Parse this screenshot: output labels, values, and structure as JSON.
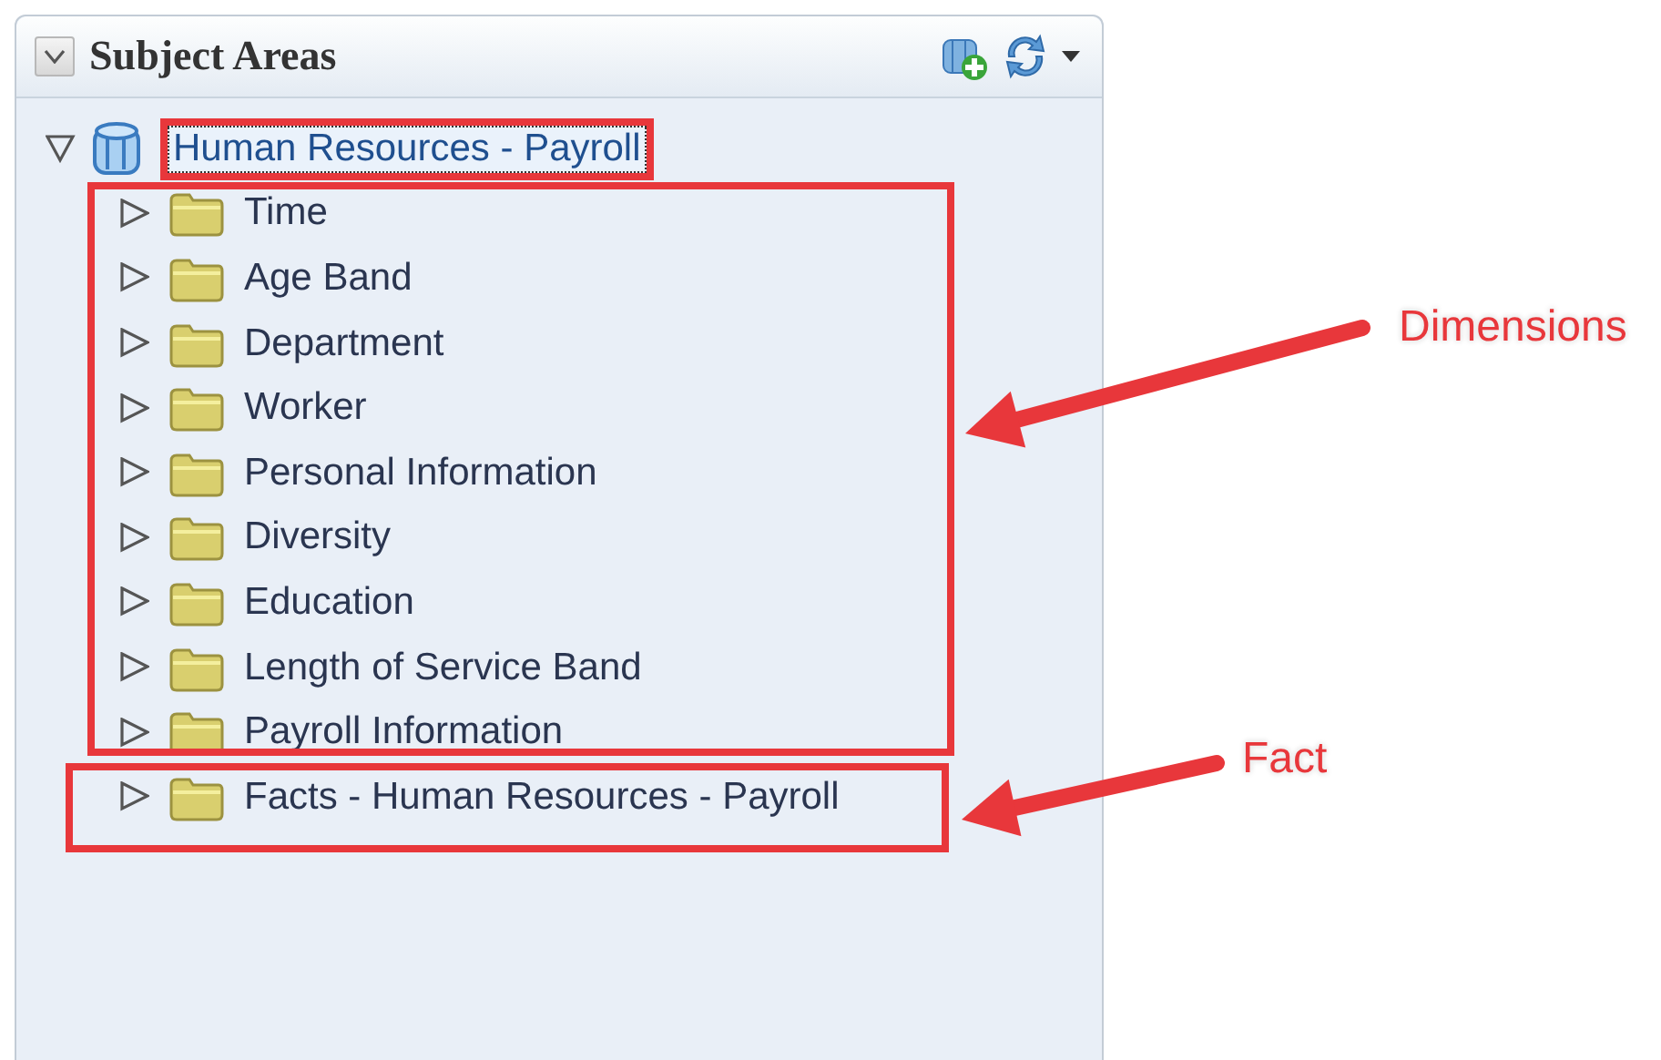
{
  "panel": {
    "title": "Subject Areas",
    "collapsed": false
  },
  "tree": {
    "label": "Human Resources - Payroll",
    "expanded": true,
    "highlighted": true,
    "children": [
      {
        "label": "Time",
        "expanded": false
      },
      {
        "label": "Age Band",
        "expanded": false
      },
      {
        "label": "Department",
        "expanded": false
      },
      {
        "label": "Worker",
        "expanded": false
      },
      {
        "label": "Personal Information",
        "expanded": false
      },
      {
        "label": "Diversity",
        "expanded": false
      },
      {
        "label": "Education",
        "expanded": false
      },
      {
        "label": "Length of Service Band",
        "expanded": false
      },
      {
        "label": "Payroll Information",
        "expanded": false
      },
      {
        "label": "Facts - Human Resources - Payroll",
        "expanded": false
      }
    ]
  },
  "annotations": [
    {
      "label": "Dimensions"
    },
    {
      "label": "Fact"
    }
  ]
}
